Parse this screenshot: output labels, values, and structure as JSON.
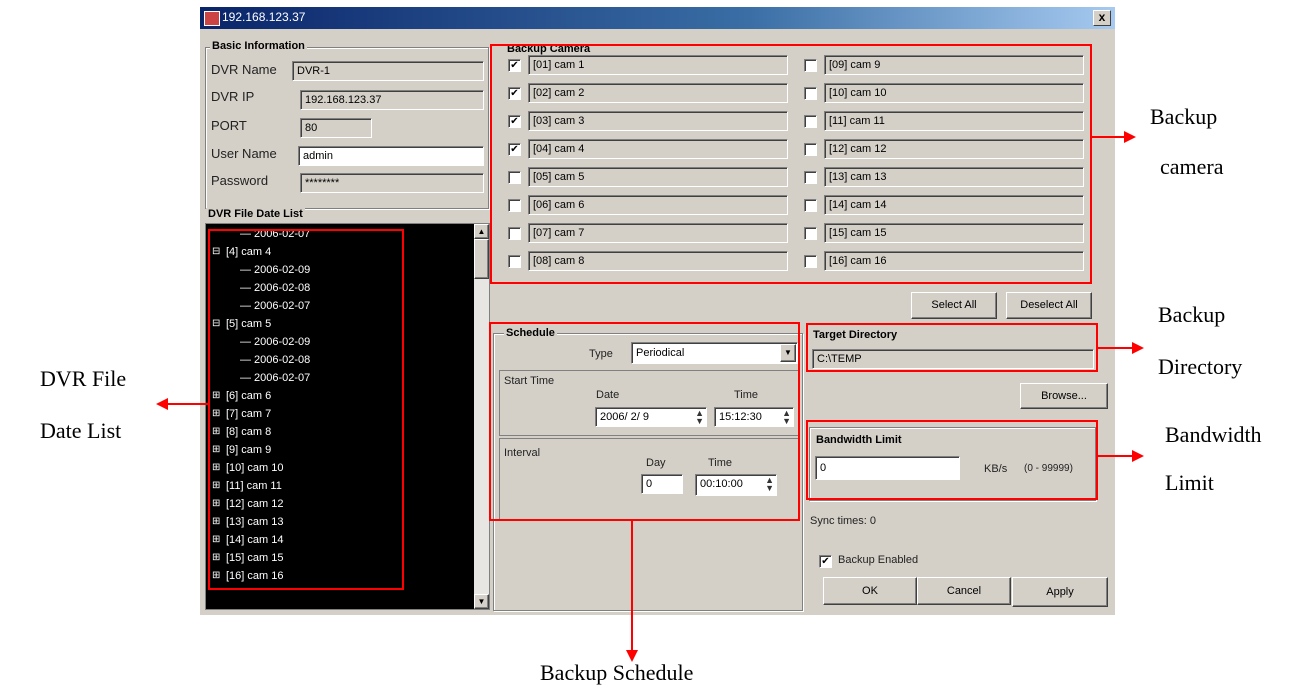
{
  "window": {
    "title": "192.168.123.37",
    "close": "x"
  },
  "basic_info": {
    "title": "Basic Information",
    "dvr_name_label": "DVR Name",
    "dvr_name": "DVR-1",
    "dvr_ip_label": "DVR IP",
    "dvr_ip": "192.168.123.37",
    "port_label": "PORT",
    "port": "80",
    "user_label": "User Name",
    "user": "admin",
    "password_label": "Password",
    "password": "********"
  },
  "file_list": {
    "title": "DVR File Date List",
    "items": [
      "2006-02-07",
      "[4] cam 4",
      "2006-02-09",
      "2006-02-08",
      "2006-02-07",
      "[5] cam 5",
      "2006-02-09",
      "2006-02-08",
      "2006-02-07",
      "[6] cam 6",
      "[7] cam 7",
      "[8] cam 8",
      "[9] cam 9",
      "[10] cam 10",
      "[11] cam 11",
      "[12] cam 12",
      "[13] cam 13",
      "[14] cam 14",
      "[15] cam 15",
      "[16] cam 16"
    ]
  },
  "backup_camera": {
    "title": "Backup Camera",
    "left": [
      {
        "label": "[01] cam 1",
        "checked": "✔"
      },
      {
        "label": "[02] cam 2",
        "checked": "✔"
      },
      {
        "label": "[03] cam 3",
        "checked": "✔"
      },
      {
        "label": "[04] cam 4",
        "checked": "✔"
      },
      {
        "label": "[05] cam 5",
        "checked": ""
      },
      {
        "label": "[06] cam 6",
        "checked": ""
      },
      {
        "label": "[07] cam 7",
        "checked": ""
      },
      {
        "label": "[08] cam 8",
        "checked": ""
      }
    ],
    "right": [
      {
        "label": "[09] cam 9",
        "checked": ""
      },
      {
        "label": "[10] cam 10",
        "checked": ""
      },
      {
        "label": "[11] cam 11",
        "checked": ""
      },
      {
        "label": "[12] cam 12",
        "checked": ""
      },
      {
        "label": "[13] cam 13",
        "checked": ""
      },
      {
        "label": "[14] cam 14",
        "checked": ""
      },
      {
        "label": "[15] cam 15",
        "checked": ""
      },
      {
        "label": "[16] cam 16",
        "checked": ""
      }
    ],
    "select_all": "Select All",
    "deselect_all": "Deselect All"
  },
  "schedule": {
    "title": "Schedule",
    "type_label": "Type",
    "type_value": "Periodical",
    "start_label": "Start Time",
    "date_label": "Date",
    "date_value": "2006/ 2/ 9",
    "time_label": "Time",
    "time_value": "15:12:30",
    "interval_label": "Interval",
    "day_label": "Day",
    "day_value": "0",
    "itime_label": "Time",
    "itime_value": "00:10:00"
  },
  "target": {
    "title": "Target Directory",
    "path": "C:\\TEMP",
    "browse": "Browse..."
  },
  "bandwidth": {
    "title": "Bandwidth Limit",
    "value": "0",
    "unit": "KB/s",
    "range": "(0 - 99999)"
  },
  "sync": "Sync times: 0",
  "backup_enabled": {
    "label": "Backup Enabled",
    "checked": "✔"
  },
  "buttons": {
    "ok": "OK",
    "cancel": "Cancel",
    "apply": "Apply"
  },
  "annotations": {
    "backup_camera": [
      "Backup",
      "camera"
    ],
    "backup_directory": [
      "Backup",
      "Directory"
    ],
    "bandwidth_limit": [
      "Bandwidth",
      "Limit"
    ],
    "dvr_file_list": [
      "DVR File",
      "Date List"
    ],
    "backup_schedule": "Backup Schedule"
  },
  "colors": {
    "highlight": "#ff0000",
    "dialog": "#d4d0c8",
    "title_bar": "#0a246a"
  }
}
